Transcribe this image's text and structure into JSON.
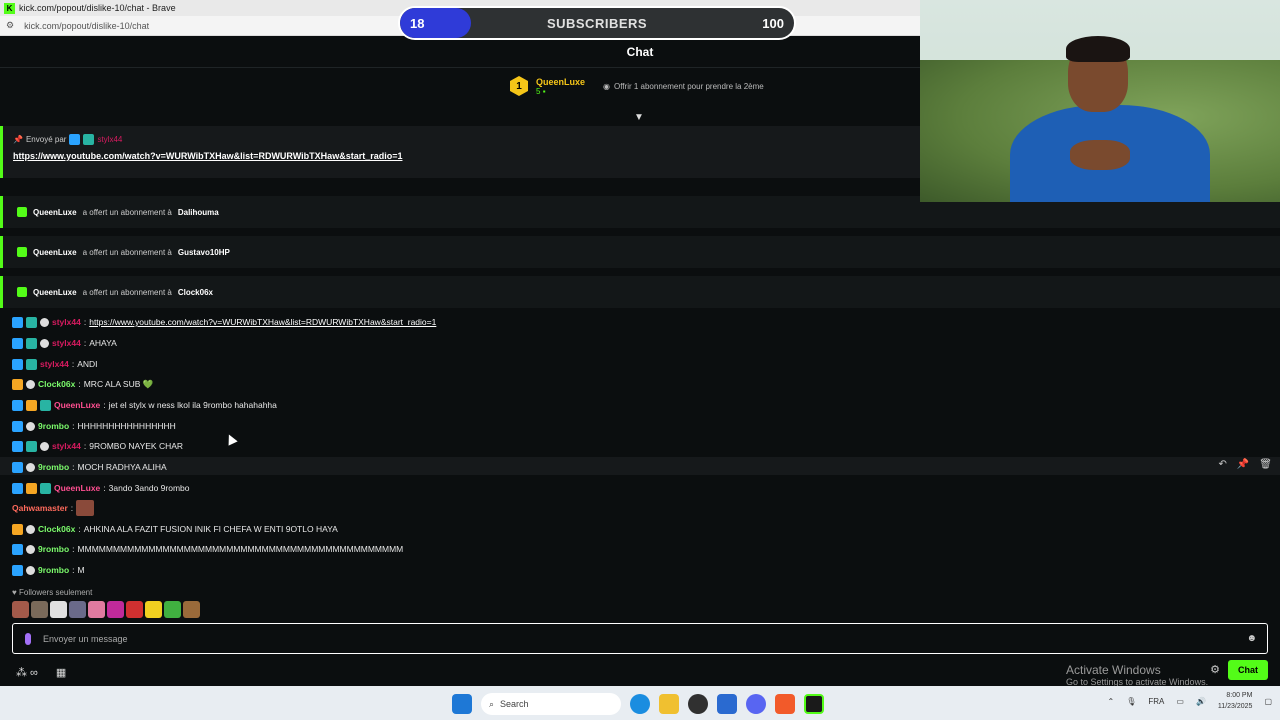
{
  "browser": {
    "title": "kick.com/popout/dislike-10/chat - Brave",
    "url": "kick.com/popout/dislike-10/chat"
  },
  "overlay": {
    "sub_current": "18",
    "sub_label": "SUBSCRIBERS",
    "sub_goal": "100",
    "sub_progress": 0.18
  },
  "chat": {
    "header": "Chat",
    "leaderboard": {
      "rank": "1",
      "name": "QueenLuxe",
      "count": "5",
      "offer": "Offrir 1 abonnement pour prendre la 2ème"
    },
    "pinned": {
      "label": "Envoyé par",
      "user": "stylx44",
      "link": "https://www.youtube.com/watch?v=WURWibTXHaw&list=RDWURWibTXHaw&start_radio=1"
    },
    "gifts": [
      {
        "user": "QueenLuxe",
        "text": "a offert un abonnement à",
        "recipient": "Dalihouma"
      },
      {
        "user": "QueenLuxe",
        "text": "a offert un abonnement à",
        "recipient": "Gustavo10HP"
      },
      {
        "user": "QueenLuxe",
        "text": "a offert un abonnement à",
        "recipient": "Clock06x"
      }
    ],
    "messages": [
      {
        "user": "stylx44",
        "text": "https://www.youtube.com/watch?v=WURWibTXHaw&list=RDWURWibTXHaw&start_radio=1"
      },
      {
        "user": "stylx44",
        "text": "AHAYA"
      },
      {
        "user": "stylx44",
        "text": "ANDI"
      },
      {
        "user": "Clock06x",
        "text": "MRC ALA SUB 💚"
      },
      {
        "user": "QueenLuxe",
        "text": "jet el stylx w ness lkol ila 9rombo hahahahha"
      },
      {
        "user": "9rombo",
        "text": "HHHHHHHHHHHHHHHH"
      },
      {
        "user": "stylx44",
        "text": "9ROMBO NAYEK CHAR"
      },
      {
        "user": "9rombo",
        "text": "MOCH RADHYA ALIHA"
      },
      {
        "user": "QueenLuxe",
        "text": "3ando 3ando 9rombo"
      },
      {
        "user": "Qahwamaster",
        "text": ""
      },
      {
        "user": "Clock06x",
        "text": "AHKINA ALA FAZIT FUSION INIK FI CHEFA W ENTI 9OTLO HAYA"
      },
      {
        "user": "9rombo",
        "text": "MMMMMMMMMMMMMMMMMMMMMMMMMMMMMMMMMMMMMMMMMMMMMM"
      },
      {
        "user": "9rombo",
        "text": "M"
      }
    ],
    "followers_only": "Followers seulement",
    "input_placeholder": "Envoyer un message",
    "chat_button": "Chat"
  },
  "windows": {
    "activate_title": "Activate Windows",
    "activate_sub": "Go to Settings to activate Windows."
  },
  "taskbar": {
    "search": "Search",
    "lang": "FRA",
    "time": "8:00 PM",
    "date": "11/23/2025"
  }
}
